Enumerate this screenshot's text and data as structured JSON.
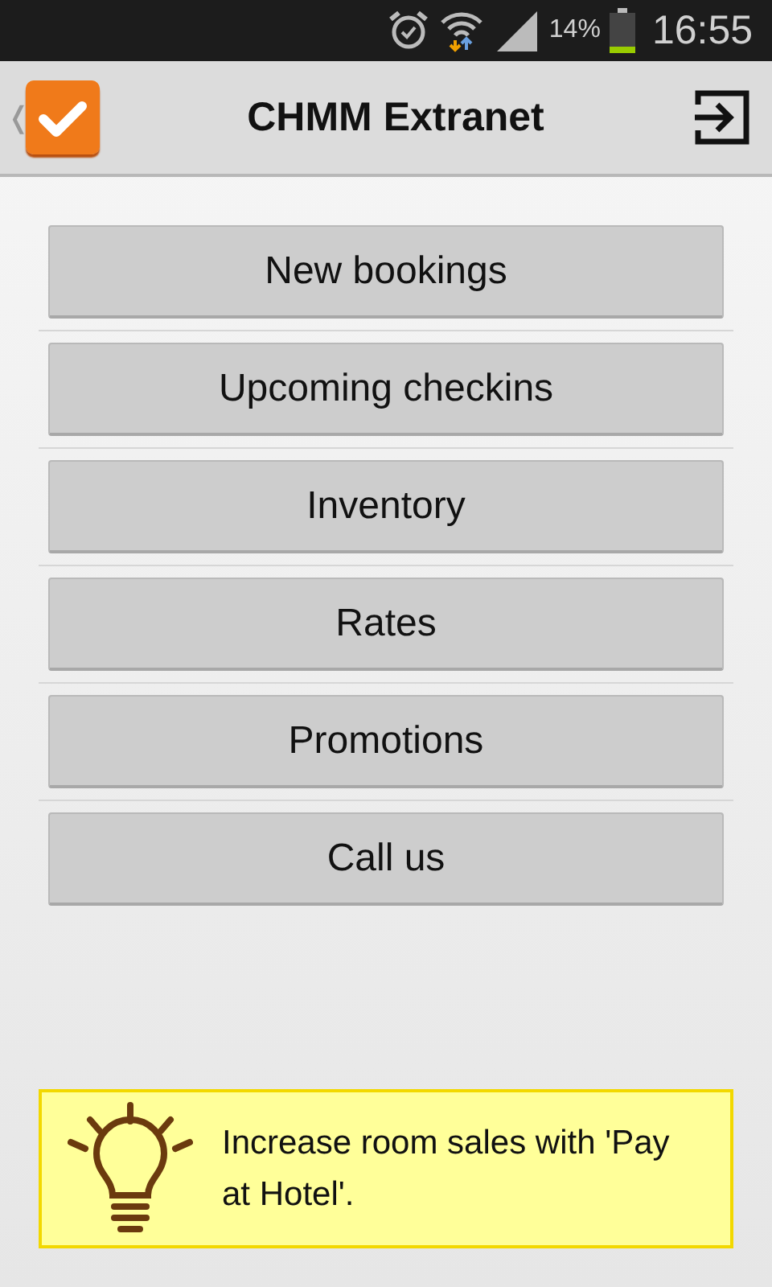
{
  "status_bar": {
    "battery_percent": "14%",
    "time": "16:55"
  },
  "action_bar": {
    "title": "CHMM Extranet",
    "back": "❬"
  },
  "menu": [
    {
      "label": "New bookings"
    },
    {
      "label": "Upcoming checkins"
    },
    {
      "label": "Inventory"
    },
    {
      "label": "Rates"
    },
    {
      "label": "Promotions"
    },
    {
      "label": "Call us"
    }
  ],
  "tip": {
    "text": "Increase room sales with 'Pay at Hotel'."
  }
}
